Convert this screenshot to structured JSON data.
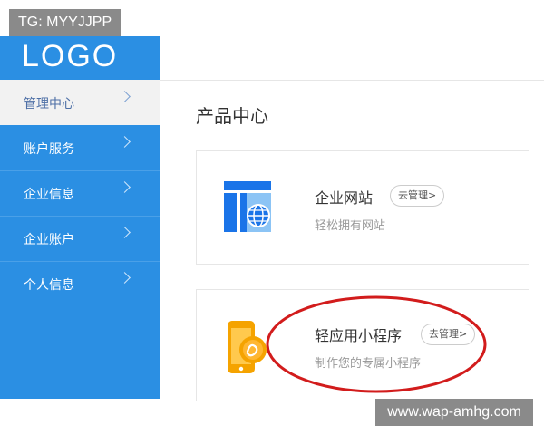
{
  "watermark_top": "TG: MYYJJPP",
  "logo": "LOGO",
  "sidebar": {
    "items": [
      {
        "label": "管理中心"
      },
      {
        "label": "账户服务"
      },
      {
        "label": "企业信息"
      },
      {
        "label": "企业账户"
      },
      {
        "label": "个人信息"
      }
    ]
  },
  "main": {
    "title": "产品中心",
    "cards": [
      {
        "title": "企业网站",
        "button": "去管理>",
        "desc": "轻松拥有网站"
      },
      {
        "title": "轻应用小程序",
        "button": "去管理>",
        "desc": "制作您的专属小程序"
      }
    ]
  },
  "watermark_bottom": "www.wap-amhg.com",
  "colors": {
    "sidebar_bg": "#2b8fe3",
    "active_item_bg": "#f2f2f2",
    "highlight_ellipse": "#d21c1c",
    "icon_blue": "#1a74e8",
    "icon_orange": "#f5a300"
  }
}
